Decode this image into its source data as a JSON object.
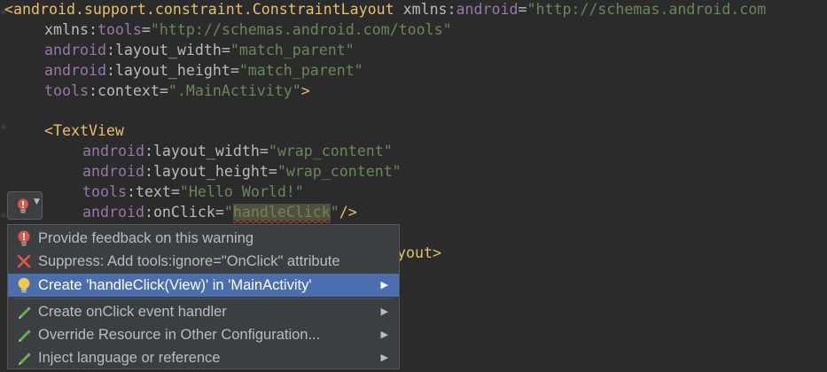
{
  "editor": {
    "line1": {
      "open": "<",
      "tag": "android.support.constraint.ConstraintLayout",
      "sp": " ",
      "ns": "xmlns",
      "colon": ":",
      "name": "android",
      "eq": "=",
      "val": "\"http://schemas.android.com"
    },
    "line2": {
      "ns": "xmlns",
      "colon": ":",
      "name": "tools",
      "eq": "=",
      "val": "\"http://schemas.android.com/tools\""
    },
    "line3": {
      "ns": "android",
      "colon": ":",
      "name": "layout_width",
      "eq": "=",
      "val": "\"match_parent\""
    },
    "line4": {
      "ns": "android",
      "colon": ":",
      "name": "layout_height",
      "eq": "=",
      "val": "\"match_parent\""
    },
    "line5": {
      "ns": "tools",
      "colon": ":",
      "name": "context",
      "eq": "=",
      "val": "\".MainActivity\"",
      "close": ">"
    },
    "line7": {
      "tag": "<TextView"
    },
    "line8": {
      "ns": "android",
      "colon": ":",
      "name": "layout_width",
      "eq": "=",
      "val": "\"wrap_content\""
    },
    "line9": {
      "ns": "android",
      "colon": ":",
      "name": "layout_height",
      "eq": "=",
      "val": "\"wrap_content\""
    },
    "line10": {
      "ns": "tools",
      "colon": ":",
      "name": "text",
      "eq": "=",
      "val": "\"Hello World!\""
    },
    "line11": {
      "ns": "android",
      "colon": ":",
      "name": "onClick",
      "eq": "=",
      "q1": "\"",
      "warn": "handleClick",
      "q2": "\"",
      "close": "/>"
    },
    "line13": {
      "tag": "ayout>"
    }
  },
  "intention_menu": {
    "items": [
      {
        "label": "Provide feedback on this warning",
        "icon": "warning-bulb-icon"
      },
      {
        "label": "Suppress: Add tools:ignore=\"OnClick\" attribute",
        "icon": "red-x-icon"
      },
      {
        "label": "Create 'handleClick(View)' in 'MainActivity'",
        "icon": "lightbulb-icon",
        "arrow": "▶"
      },
      {
        "label": "Create onClick event handler",
        "icon": "pencil-icon",
        "arrow": "▶"
      },
      {
        "label": "Override Resource in Other Configuration...",
        "icon": "pencil-icon",
        "arrow": "▶"
      },
      {
        "label": "Inject language or reference",
        "icon": "pencil-icon",
        "arrow": "▶"
      }
    ],
    "selected_index": 2
  },
  "bulb_button": {
    "icon": "red-bulb-icon",
    "chevron": "▼"
  },
  "colors": {
    "background": "#2b2b2b",
    "tag": "#e8bf6a",
    "namespace": "#9876aa",
    "attribute": "#bababa",
    "string": "#6a8759",
    "selection": "#4b6eaf",
    "menu_bg": "#3c3f41"
  }
}
